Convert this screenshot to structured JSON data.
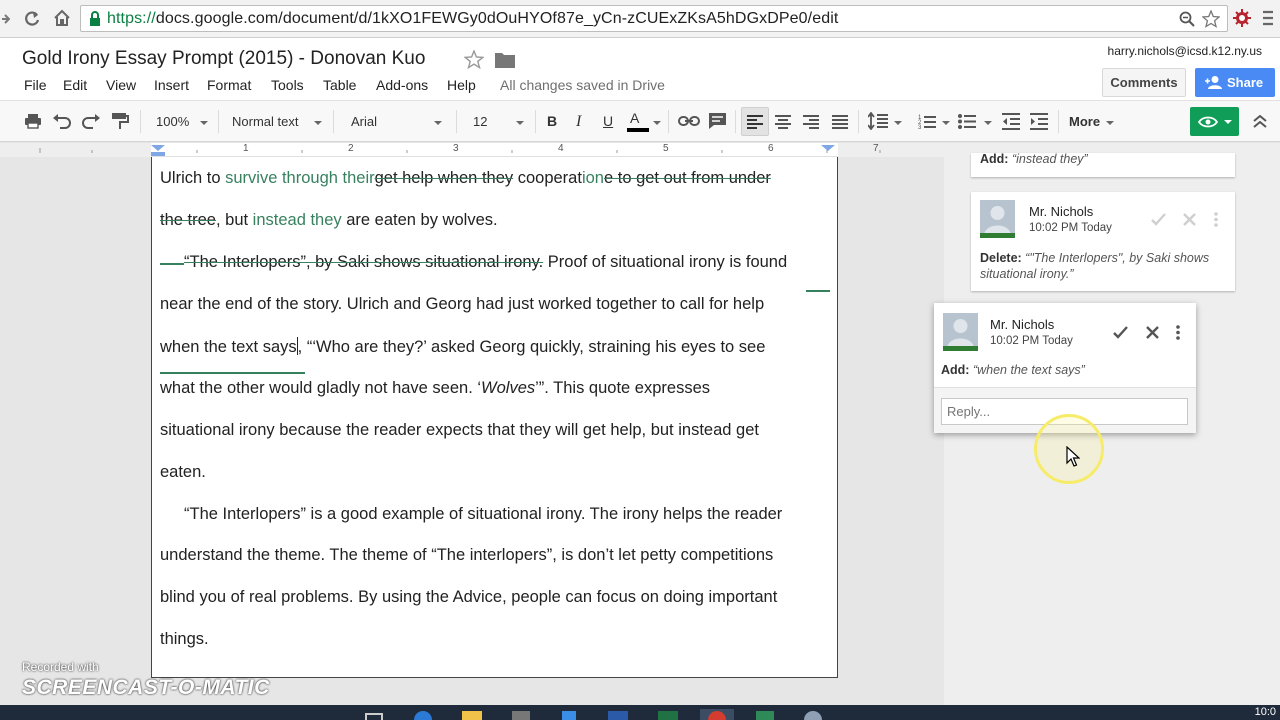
{
  "browser": {
    "url_scheme": "https://",
    "url_rest": "docs.google.com/document/d/1kXO1FEWGy0dOuHYOf87e_yCn-zCUExZKsA5hDGxDPe0/edit"
  },
  "doc": {
    "title": "Gold Irony Essay Prompt (2015) - Donovan Kuo",
    "menu": [
      "File",
      "Edit",
      "View",
      "Insert",
      "Format",
      "Tools",
      "Table",
      "Add-ons",
      "Help"
    ],
    "save_status": "All changes saved in Drive",
    "user_email": "harry.nichols@icsd.k12.ny.us",
    "comments_label": "Comments",
    "share_label": "Share"
  },
  "toolbar": {
    "zoom": "100%",
    "style": "Normal text",
    "font": "Arial",
    "size": "12",
    "bold": "B",
    "italic": "I",
    "underline": "U",
    "text_color": "A",
    "more": "More"
  },
  "ruler": {
    "numbers": [
      "1",
      "2",
      "3",
      "4",
      "5",
      "6",
      "7"
    ]
  },
  "body": {
    "l1": {
      "a": "Ulrich to ",
      "b": "survive through their",
      "c": "get help when they",
      "d": " cooperat",
      "e": "ion",
      "f": "e to get out from under"
    },
    "l2": {
      "a": "the tree",
      "b": ", but ",
      "c": "instead they",
      "d": " are eaten by wolves."
    },
    "l3": {
      "a": "“The Interlopers”, by Saki shows situational irony.",
      "b": " Proof of situational irony is found"
    },
    "l4": "near the end of the story. Ulrich and Georg had just worked together to call for help",
    "l5": {
      "a": "when the text says",
      "b": ", “‘Who are they?’ asked Georg quickly, straining his eyes to see"
    },
    "l6": {
      "a": "what the other would gladly not have seen. ‘",
      "b": "Wolves",
      "c": "’”. This quote expresses"
    },
    "l7": "situational irony because the reader expects that they will get help, but instead get",
    "l8": "eaten.",
    "l9": "“The Interlopers” is a good example of situational irony. The irony helps the reader",
    "l10": "understand the theme. The theme of “The interlopers”, is don’t let petty competitions",
    "l11": "blind you of real problems. By using the Advice, people can focus on doing important",
    "l12": "things."
  },
  "comments": {
    "c0": {
      "action": "Add:",
      "text": "“instead they”"
    },
    "c1": {
      "name": "Mr. Nichols",
      "time": "10:02 PM Today",
      "action": "Delete:",
      "text": "“\"The Interlopers\", by Saki shows situational irony.”"
    },
    "c2": {
      "name": "Mr. Nichols",
      "time": "10:02 PM Today",
      "action": "Add:",
      "text": "“when the text says”",
      "reply_placeholder": "Reply..."
    }
  },
  "watermark": {
    "line1": "Recorded with",
    "line2": "SCREENCAST-O-MATIC"
  },
  "clock": "10:0"
}
